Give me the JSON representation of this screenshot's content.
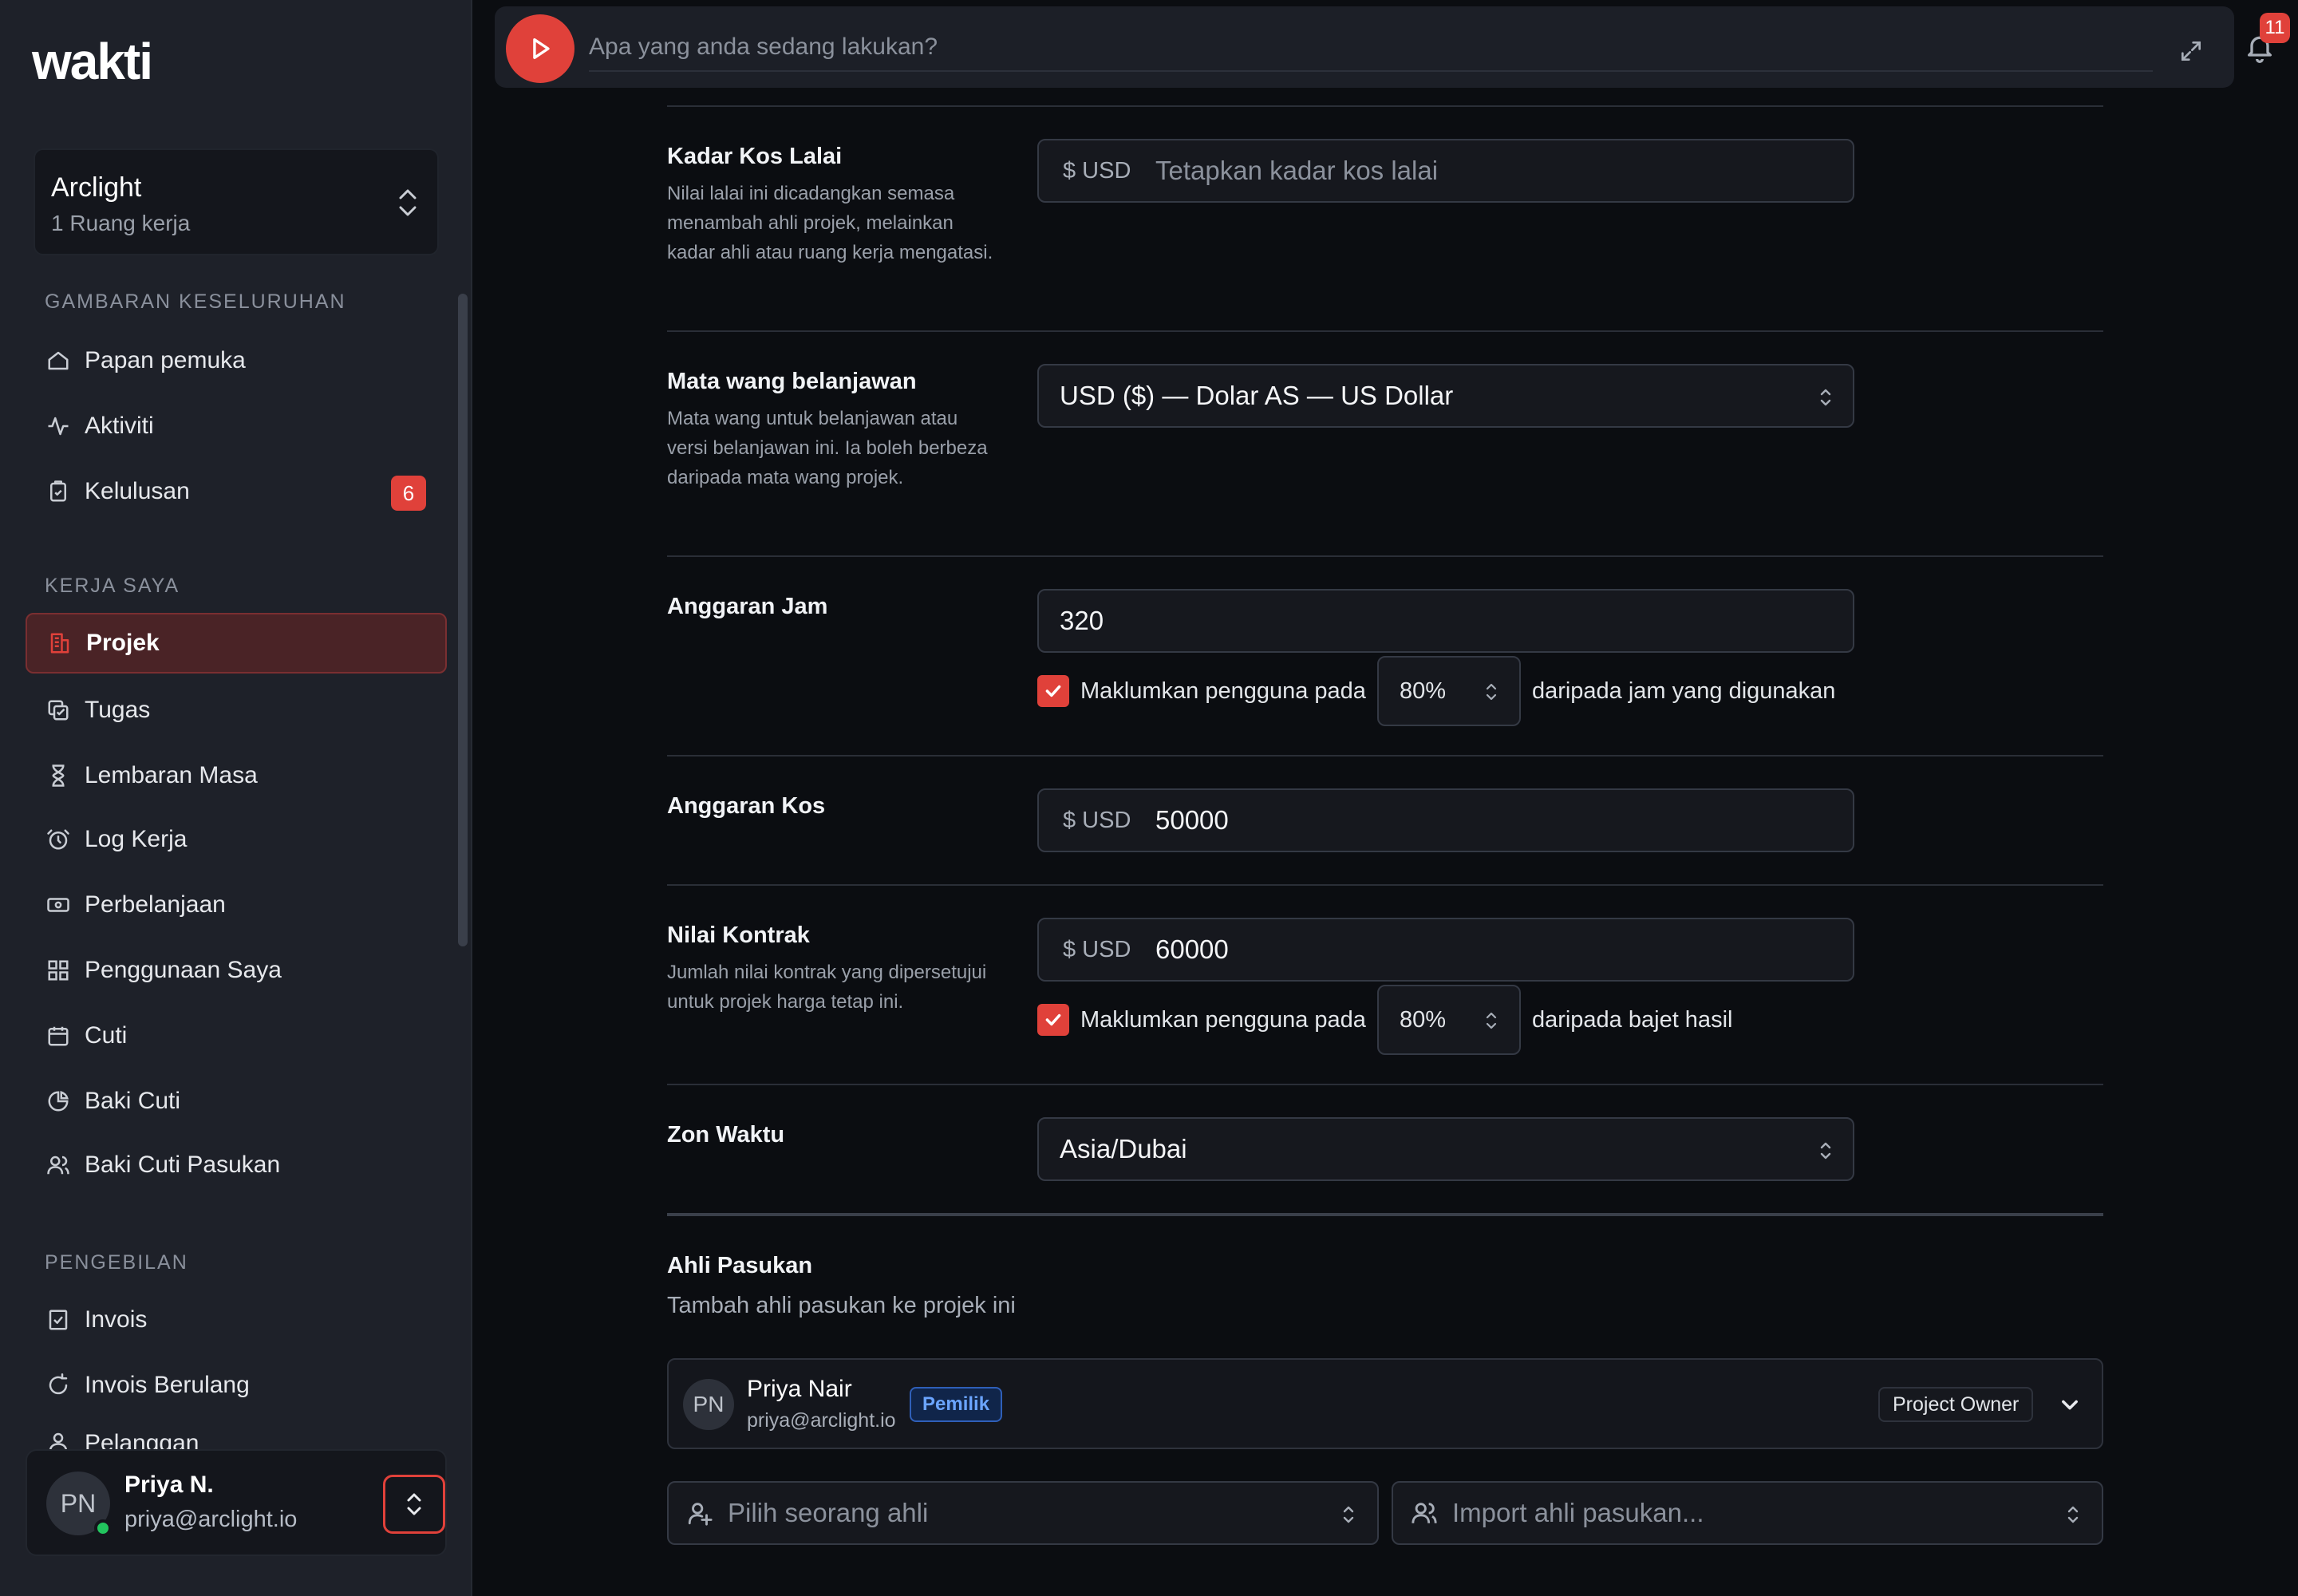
{
  "app": {
    "logo": "wakti"
  },
  "workspace": {
    "name": "Arclight",
    "subtitle": "1 Ruang kerja"
  },
  "sidebar": {
    "sections": [
      {
        "title": "GAMBARAN KESELURUHAN"
      },
      {
        "title": "KERJA SAYA"
      },
      {
        "title": "PENGEBILAN"
      }
    ],
    "items": [
      {
        "label": "Papan pemuka",
        "icon": "home-icon"
      },
      {
        "label": "Aktiviti",
        "icon": "activity-icon"
      },
      {
        "label": "Kelulusan",
        "icon": "clipboard-check-icon",
        "badge": "6"
      },
      {
        "label": "Projek",
        "icon": "building-icon",
        "active": true
      },
      {
        "label": "Tugas",
        "icon": "copy-check-icon"
      },
      {
        "label": "Lembaran Masa",
        "icon": "hourglass-icon"
      },
      {
        "label": "Log Kerja",
        "icon": "alarm-clock-icon"
      },
      {
        "label": "Perbelanjaan",
        "icon": "banknote-icon"
      },
      {
        "label": "Penggunaan Saya",
        "icon": "grid-icon"
      },
      {
        "label": "Cuti",
        "icon": "calendar-icon"
      },
      {
        "label": "Baki Cuti",
        "icon": "pie-chart-icon"
      },
      {
        "label": "Baki Cuti Pasukan",
        "icon": "users-icon"
      },
      {
        "label": "Invois",
        "icon": "invoice-check-icon"
      },
      {
        "label": "Invois Berulang",
        "icon": "refresh-icon"
      },
      {
        "label": "Pelanggan",
        "icon": "user-icon"
      }
    ]
  },
  "user": {
    "initials": "PN",
    "name": "Priya N.",
    "email": "priya@arclight.io"
  },
  "timer": {
    "placeholder": "Apa yang anda sedang lakukan?",
    "notifications": "11"
  },
  "form": {
    "default_rate": {
      "label": "Kadar Kos Lalai",
      "description": "Nilai lalai ini dicadangkan semasa menambah ahli projek, melainkan kadar ahli atau ruang kerja mengatasi.",
      "prefix": "$ USD",
      "placeholder": "Tetapkan kadar kos lalai"
    },
    "currency": {
      "label": "Mata wang belanjawan",
      "description": "Mata wang untuk belanjawan atau versi belanjawan ini. Ia boleh berbeza daripada mata wang projek.",
      "value": "USD ($) — Dolar AS — US Dollar"
    },
    "hours_budget": {
      "label": "Anggaran Jam",
      "value": "320",
      "notify_prefix": "Maklumkan pengguna pada",
      "notify_pct": "80%",
      "notify_suffix": "daripada jam yang digunakan"
    },
    "cost_budget": {
      "label": "Anggaran Kos",
      "prefix": "$ USD",
      "value": "50000"
    },
    "contract_value": {
      "label": "Nilai Kontrak",
      "description": "Jumlah nilai kontrak yang dipersetujui untuk projek harga tetap ini.",
      "prefix": "$ USD",
      "value": "60000",
      "notify_prefix": "Maklumkan pengguna pada",
      "notify_pct": "80%",
      "notify_suffix": "daripada bajet hasil"
    },
    "timezone": {
      "label": "Zon Waktu",
      "value": "Asia/Dubai"
    }
  },
  "team": {
    "title": "Ahli Pasukan",
    "subtitle": "Tambah ahli pasukan ke projek ini",
    "members": [
      {
        "initials": "PN",
        "name": "Priya Nair",
        "email": "priya@arclight.io",
        "tag": "Pemilik",
        "role": "Project Owner"
      }
    ],
    "pick_placeholder": "Pilih seorang ahli",
    "import_placeholder": "Import ahli pasukan..."
  },
  "colors": {
    "accent": "#e0413a",
    "background": "#0b0d11",
    "sidebar": "#1e2129",
    "owner_tag": "#6aa4ff"
  }
}
